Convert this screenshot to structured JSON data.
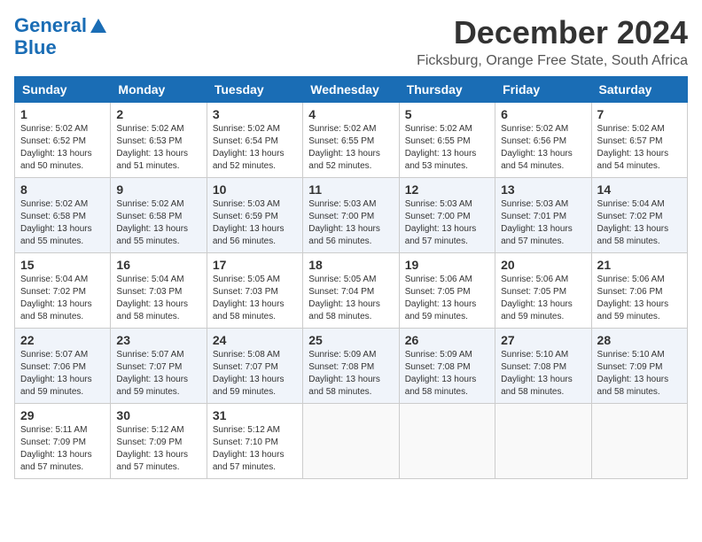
{
  "logo": {
    "line1": "General",
    "line2": "Blue"
  },
  "title": "December 2024",
  "location": "Ficksburg, Orange Free State, South Africa",
  "days_of_week": [
    "Sunday",
    "Monday",
    "Tuesday",
    "Wednesday",
    "Thursday",
    "Friday",
    "Saturday"
  ],
  "weeks": [
    [
      {
        "day": "1",
        "sunrise": "5:02 AM",
        "sunset": "6:52 PM",
        "daylight": "13 hours and 50 minutes."
      },
      {
        "day": "2",
        "sunrise": "5:02 AM",
        "sunset": "6:53 PM",
        "daylight": "13 hours and 51 minutes."
      },
      {
        "day": "3",
        "sunrise": "5:02 AM",
        "sunset": "6:54 PM",
        "daylight": "13 hours and 52 minutes."
      },
      {
        "day": "4",
        "sunrise": "5:02 AM",
        "sunset": "6:55 PM",
        "daylight": "13 hours and 52 minutes."
      },
      {
        "day": "5",
        "sunrise": "5:02 AM",
        "sunset": "6:55 PM",
        "daylight": "13 hours and 53 minutes."
      },
      {
        "day": "6",
        "sunrise": "5:02 AM",
        "sunset": "6:56 PM",
        "daylight": "13 hours and 54 minutes."
      },
      {
        "day": "7",
        "sunrise": "5:02 AM",
        "sunset": "6:57 PM",
        "daylight": "13 hours and 54 minutes."
      }
    ],
    [
      {
        "day": "8",
        "sunrise": "5:02 AM",
        "sunset": "6:58 PM",
        "daylight": "13 hours and 55 minutes."
      },
      {
        "day": "9",
        "sunrise": "5:02 AM",
        "sunset": "6:58 PM",
        "daylight": "13 hours and 55 minutes."
      },
      {
        "day": "10",
        "sunrise": "5:03 AM",
        "sunset": "6:59 PM",
        "daylight": "13 hours and 56 minutes."
      },
      {
        "day": "11",
        "sunrise": "5:03 AM",
        "sunset": "7:00 PM",
        "daylight": "13 hours and 56 minutes."
      },
      {
        "day": "12",
        "sunrise": "5:03 AM",
        "sunset": "7:00 PM",
        "daylight": "13 hours and 57 minutes."
      },
      {
        "day": "13",
        "sunrise": "5:03 AM",
        "sunset": "7:01 PM",
        "daylight": "13 hours and 57 minutes."
      },
      {
        "day": "14",
        "sunrise": "5:04 AM",
        "sunset": "7:02 PM",
        "daylight": "13 hours and 58 minutes."
      }
    ],
    [
      {
        "day": "15",
        "sunrise": "5:04 AM",
        "sunset": "7:02 PM",
        "daylight": "13 hours and 58 minutes."
      },
      {
        "day": "16",
        "sunrise": "5:04 AM",
        "sunset": "7:03 PM",
        "daylight": "13 hours and 58 minutes."
      },
      {
        "day": "17",
        "sunrise": "5:05 AM",
        "sunset": "7:03 PM",
        "daylight": "13 hours and 58 minutes."
      },
      {
        "day": "18",
        "sunrise": "5:05 AM",
        "sunset": "7:04 PM",
        "daylight": "13 hours and 58 minutes."
      },
      {
        "day": "19",
        "sunrise": "5:06 AM",
        "sunset": "7:05 PM",
        "daylight": "13 hours and 59 minutes."
      },
      {
        "day": "20",
        "sunrise": "5:06 AM",
        "sunset": "7:05 PM",
        "daylight": "13 hours and 59 minutes."
      },
      {
        "day": "21",
        "sunrise": "5:06 AM",
        "sunset": "7:06 PM",
        "daylight": "13 hours and 59 minutes."
      }
    ],
    [
      {
        "day": "22",
        "sunrise": "5:07 AM",
        "sunset": "7:06 PM",
        "daylight": "13 hours and 59 minutes."
      },
      {
        "day": "23",
        "sunrise": "5:07 AM",
        "sunset": "7:07 PM",
        "daylight": "13 hours and 59 minutes."
      },
      {
        "day": "24",
        "sunrise": "5:08 AM",
        "sunset": "7:07 PM",
        "daylight": "13 hours and 59 minutes."
      },
      {
        "day": "25",
        "sunrise": "5:09 AM",
        "sunset": "7:08 PM",
        "daylight": "13 hours and 58 minutes."
      },
      {
        "day": "26",
        "sunrise": "5:09 AM",
        "sunset": "7:08 PM",
        "daylight": "13 hours and 58 minutes."
      },
      {
        "day": "27",
        "sunrise": "5:10 AM",
        "sunset": "7:08 PM",
        "daylight": "13 hours and 58 minutes."
      },
      {
        "day": "28",
        "sunrise": "5:10 AM",
        "sunset": "7:09 PM",
        "daylight": "13 hours and 58 minutes."
      }
    ],
    [
      {
        "day": "29",
        "sunrise": "5:11 AM",
        "sunset": "7:09 PM",
        "daylight": "13 hours and 57 minutes."
      },
      {
        "day": "30",
        "sunrise": "5:12 AM",
        "sunset": "7:09 PM",
        "daylight": "13 hours and 57 minutes."
      },
      {
        "day": "31",
        "sunrise": "5:12 AM",
        "sunset": "7:10 PM",
        "daylight": "13 hours and 57 minutes."
      },
      null,
      null,
      null,
      null
    ]
  ],
  "labels": {
    "sunrise": "Sunrise:",
    "sunset": "Sunset:",
    "daylight": "Daylight:"
  }
}
